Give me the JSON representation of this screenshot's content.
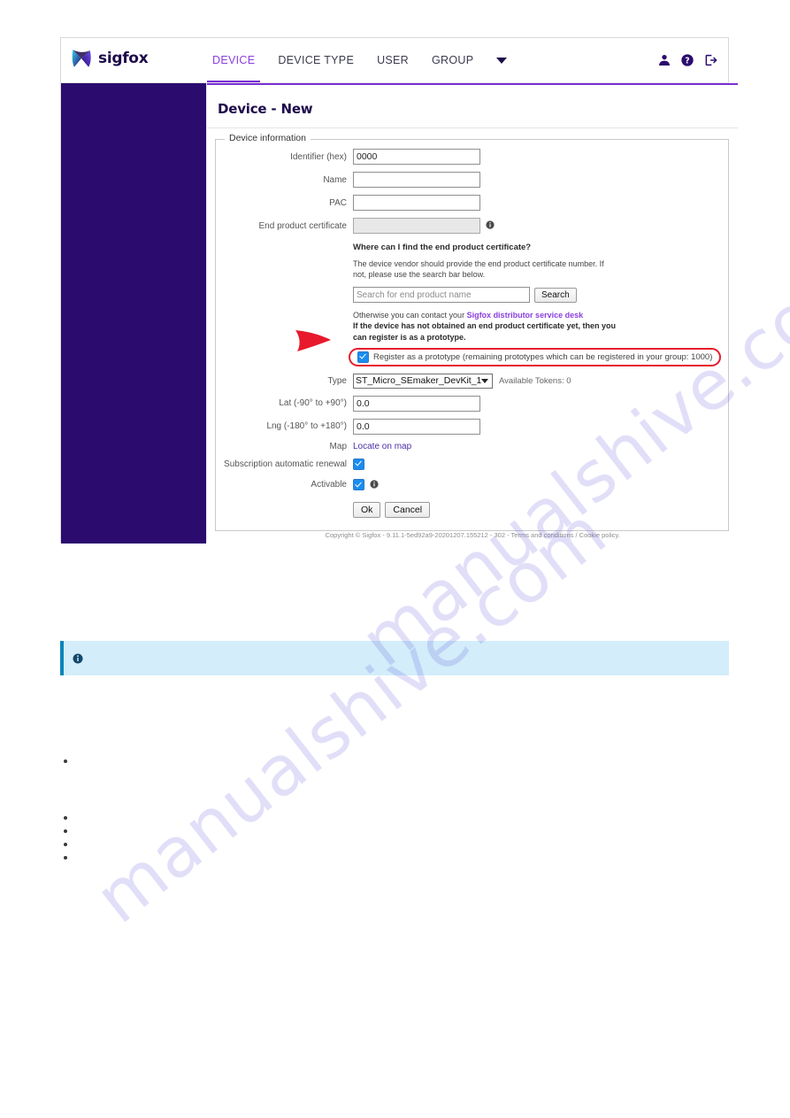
{
  "brand": {
    "logo_word": "sigfox",
    "logo_icon": "sigfox-butterfly-logo"
  },
  "nav": {
    "items": [
      {
        "label": "DEVICE",
        "active": true
      },
      {
        "label": "DEVICE TYPE",
        "active": false
      },
      {
        "label": "USER",
        "active": false
      },
      {
        "label": "GROUP",
        "active": false
      }
    ],
    "more_icon": "chevron-down-icon",
    "right_icons": [
      "user-icon",
      "help-icon",
      "logout-icon"
    ]
  },
  "page": {
    "title": "Device - New"
  },
  "fieldset": {
    "legend": "Device information"
  },
  "form": {
    "identifier": {
      "label": "Identifier (hex)",
      "value": "0000"
    },
    "name": {
      "label": "Name",
      "value": ""
    },
    "pac": {
      "label": "PAC",
      "value": ""
    },
    "end_product_certificate": {
      "label": "End product certificate",
      "value": ""
    },
    "type": {
      "label": "Type",
      "value": "ST_Micro_SEmaker_DevKit_1"
    },
    "tokens": "Available Tokens: 0",
    "lat": {
      "label": "Lat (-90° to +90°)",
      "value": "0.0"
    },
    "lng": {
      "label": "Lng (-180° to +180°)",
      "value": "0.0"
    },
    "map": {
      "label": "Map",
      "link": "Locate on map"
    },
    "subscription_renewal": {
      "label": "Subscription automatic renewal",
      "checked": true
    },
    "activable": {
      "label": "Activable",
      "checked": true
    },
    "ok_label": "Ok",
    "cancel_label": "Cancel"
  },
  "help": {
    "question": "Where can I find the end product certificate?",
    "paragraph": "The device vendor should provide the end product certificate number. If not, please use the search bar below.",
    "search_placeholder": "Search for end product name",
    "search_button": "Search",
    "otherwise_prefix": "Otherwise you can contact your ",
    "otherwise_link": "Sigfox distributor service desk",
    "prototype_note": "If the device has not obtained an end product certificate yet, then you can register is as a prototype."
  },
  "prototype": {
    "label": "Register as a prototype (remaining prototypes which can be registered in your group: 1000)",
    "checked": true,
    "highlight_color": "#e8192c",
    "arrow_icon": "red-arrow-pointer"
  },
  "footer": {
    "text": "Copyright © Sigfox - 9.11.1-5ed92a9-20201207.155212 - 302 - Terms and conditions / Cookie policy."
  },
  "doc": {
    "info_icon": "info-icon",
    "watermark": "manualshive.com"
  },
  "colors": {
    "sidebar": "#2b0b6e",
    "accent": "#7b2fd4",
    "active_nav": "#8b3ee0",
    "checkbox": "#1a8cf0",
    "info_bg": "#d3edfa",
    "info_border": "#0d84b8"
  }
}
